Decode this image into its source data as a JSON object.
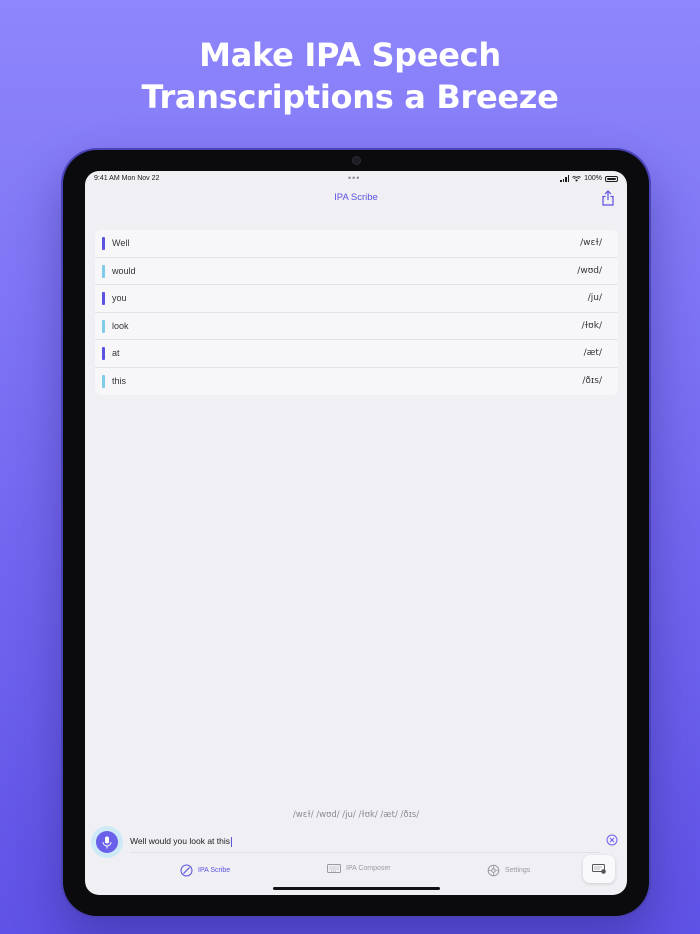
{
  "headline": {
    "line1": "Make IPA Speech",
    "line2": "Transcriptions a Breeze"
  },
  "status_bar": {
    "time": "9:41 AM   Mon Nov 22",
    "dots": "•••",
    "battery": "100%"
  },
  "nav": {
    "title": "IPA Scribe",
    "share_icon": "share-icon"
  },
  "words": [
    {
      "word": "Well",
      "ipa": "/wɛɫ/",
      "color": "#5b52e0"
    },
    {
      "word": "would",
      "ipa": "/wʊd/",
      "color": "#7fcbea"
    },
    {
      "word": "you",
      "ipa": "/ju/",
      "color": "#5b52e0"
    },
    {
      "word": "look",
      "ipa": "/ɫʊk/",
      "color": "#7fcbea"
    },
    {
      "word": "at",
      "ipa": "/æt/",
      "color": "#5b52e0"
    },
    {
      "word": "this",
      "ipa": "/ðɪs/",
      "color": "#7fcbea"
    }
  ],
  "preview": "/wɛɫ/ /wʊd/ /ju/ /ɫʊk/ /æt/ /ðɪs/",
  "input": {
    "value": "Well would you look at this"
  },
  "tabs": [
    {
      "label": "IPA Scribe",
      "icon": "pencil-circle-icon",
      "active": true
    },
    {
      "label": "IPA Composer",
      "icon": "keyboard-icon",
      "active": false
    },
    {
      "label": "Settings",
      "icon": "gear-icon",
      "active": false
    }
  ],
  "colors": {
    "accent": "#5b52e0",
    "bar_alt": "#7fcbea",
    "background": "#7468f1"
  }
}
